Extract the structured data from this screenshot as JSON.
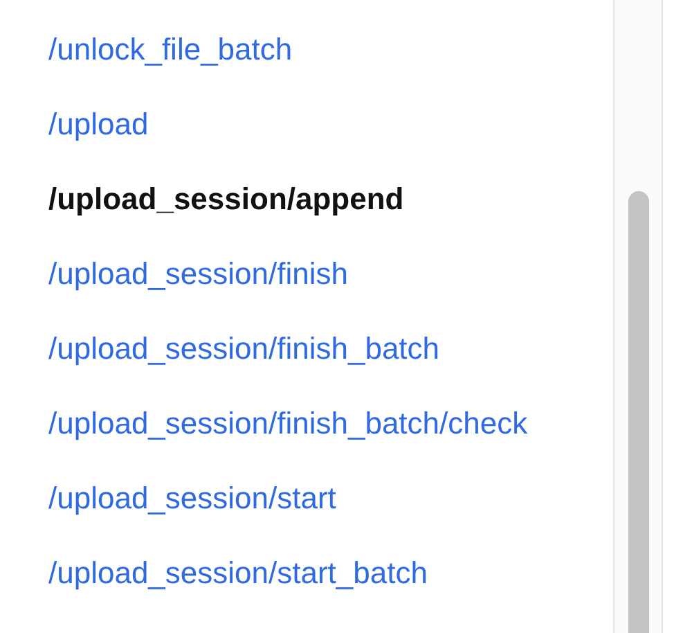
{
  "endpoints": [
    {
      "label": "/unlock_file_batch",
      "selected": false
    },
    {
      "label": "/upload",
      "selected": false
    },
    {
      "label": "/upload_session/append",
      "selected": true
    },
    {
      "label": "/upload_session/finish",
      "selected": false
    },
    {
      "label": "/upload_session/finish_batch",
      "selected": false
    },
    {
      "label": "/upload_session/finish_batch/check",
      "selected": false
    },
    {
      "label": "/upload_session/start",
      "selected": false
    },
    {
      "label": "/upload_session/start_batch",
      "selected": false
    }
  ]
}
